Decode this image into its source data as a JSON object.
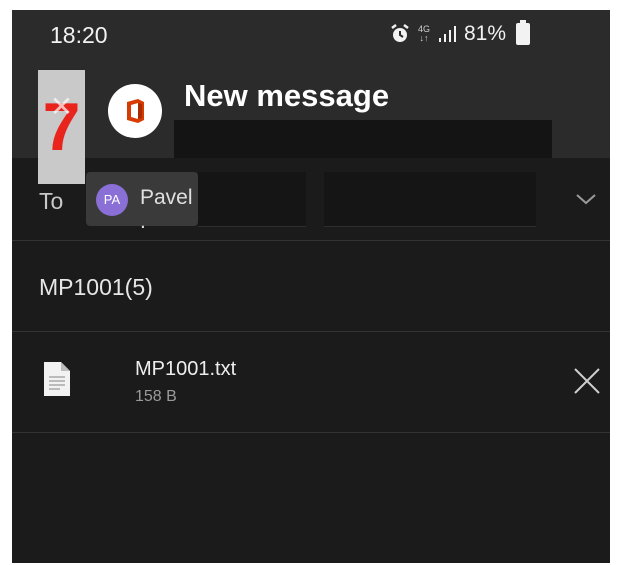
{
  "status_bar": {
    "time": "18:20",
    "network": "4G",
    "battery": "81%"
  },
  "overlay": {
    "step_number": "7"
  },
  "header": {
    "title": "New message",
    "app_icon": "office-logo-icon"
  },
  "to": {
    "label": "To",
    "recipient_initials": "PA",
    "recipient_name": "Pavel ."
  },
  "subject": "MP1001(5)",
  "attachment": {
    "name": "MP1001.txt",
    "size": "158 B"
  },
  "colors": {
    "background": "#1b1b1b",
    "header": "#2b2b2b",
    "avatar": "#8a6fd6",
    "office_red": "#d83b01",
    "step_badge": "#e8241c"
  }
}
